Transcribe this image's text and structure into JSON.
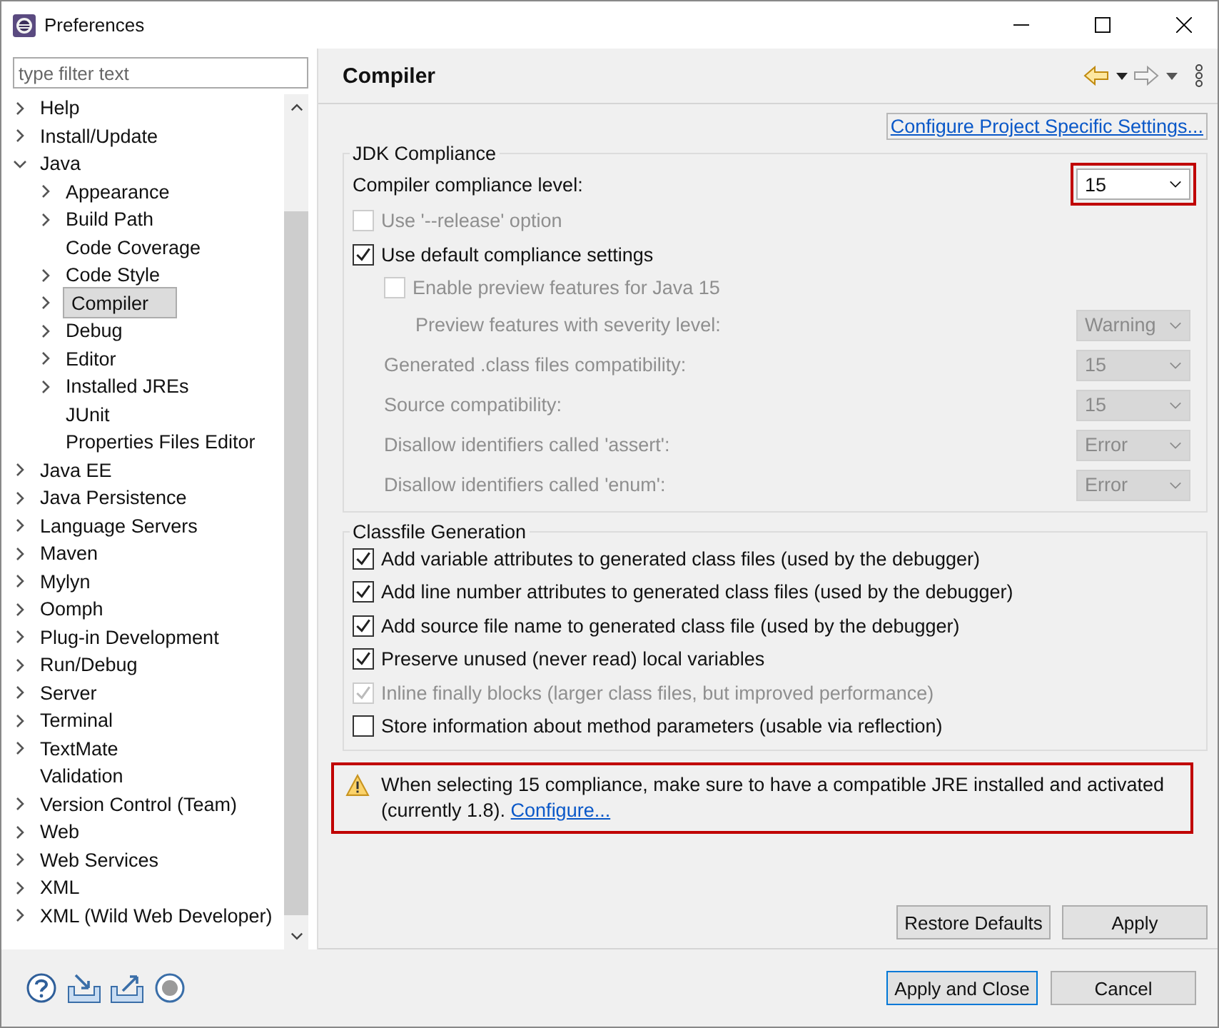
{
  "window": {
    "title": "Preferences"
  },
  "filter": {
    "placeholder": "type filter text"
  },
  "tree": [
    {
      "label": "Help",
      "kind": "branch",
      "expanded": false,
      "selected": false
    },
    {
      "label": "Install/Update",
      "kind": "branch",
      "expanded": false,
      "selected": false
    },
    {
      "label": "Java",
      "kind": "branch",
      "expanded": true,
      "selected": false,
      "children": [
        {
          "label": "Appearance",
          "kind": "branch",
          "expanded": false,
          "selected": false
        },
        {
          "label": "Build Path",
          "kind": "branch",
          "expanded": false,
          "selected": false
        },
        {
          "label": "Code Coverage",
          "kind": "leaf",
          "selected": false
        },
        {
          "label": "Code Style",
          "kind": "branch",
          "expanded": false,
          "selected": false
        },
        {
          "label": "Compiler",
          "kind": "branch",
          "expanded": false,
          "selected": true
        },
        {
          "label": "Debug",
          "kind": "branch",
          "expanded": false,
          "selected": false
        },
        {
          "label": "Editor",
          "kind": "branch",
          "expanded": false,
          "selected": false
        },
        {
          "label": "Installed JREs",
          "kind": "branch",
          "expanded": false,
          "selected": false
        },
        {
          "label": "JUnit",
          "kind": "leaf",
          "selected": false
        },
        {
          "label": "Properties Files Editor",
          "kind": "leaf",
          "selected": false
        }
      ]
    },
    {
      "label": "Java EE",
      "kind": "branch",
      "expanded": false,
      "selected": false
    },
    {
      "label": "Java Persistence",
      "kind": "branch",
      "expanded": false,
      "selected": false
    },
    {
      "label": "Language Servers",
      "kind": "branch",
      "expanded": false,
      "selected": false
    },
    {
      "label": "Maven",
      "kind": "branch",
      "expanded": false,
      "selected": false
    },
    {
      "label": "Mylyn",
      "kind": "branch",
      "expanded": false,
      "selected": false
    },
    {
      "label": "Oomph",
      "kind": "branch",
      "expanded": false,
      "selected": false
    },
    {
      "label": "Plug-in Development",
      "kind": "branch",
      "expanded": false,
      "selected": false
    },
    {
      "label": "Run/Debug",
      "kind": "branch",
      "expanded": false,
      "selected": false
    },
    {
      "label": "Server",
      "kind": "branch",
      "expanded": false,
      "selected": false
    },
    {
      "label": "Terminal",
      "kind": "branch",
      "expanded": false,
      "selected": false
    },
    {
      "label": "TextMate",
      "kind": "branch",
      "expanded": false,
      "selected": false
    },
    {
      "label": "Validation",
      "kind": "leaf",
      "selected": false
    },
    {
      "label": "Version Control (Team)",
      "kind": "branch",
      "expanded": false,
      "selected": false
    },
    {
      "label": "Web",
      "kind": "branch",
      "expanded": false,
      "selected": false
    },
    {
      "label": "Web Services",
      "kind": "branch",
      "expanded": false,
      "selected": false
    },
    {
      "label": "XML",
      "kind": "branch",
      "expanded": false,
      "selected": false
    },
    {
      "label": "XML (Wild Web Developer)",
      "kind": "branch",
      "expanded": false,
      "selected": false
    }
  ],
  "page": {
    "title": "Compiler",
    "project_link": "Configure Project Specific Settings..."
  },
  "jdk_compliance": {
    "title": "JDK Compliance",
    "rows": [
      {
        "kind": "select",
        "label": "Compiler compliance level:",
        "value": "15",
        "disabled": false,
        "highlighted": true
      },
      {
        "kind": "checkbox",
        "label": "Use '--release' option",
        "checked": false,
        "disabled": true
      },
      {
        "kind": "checkbox",
        "label": "Use default compliance settings",
        "checked": true,
        "disabled": false
      },
      {
        "kind": "sub-checkbox",
        "label": "Enable preview features for Java 15",
        "checked": false,
        "disabled": true
      },
      {
        "kind": "sub-sub-select",
        "label": "Preview features with severity level:",
        "value": "Warning",
        "disabled": true,
        "highlighted": false
      },
      {
        "kind": "sub-select",
        "label": "Generated .class files compatibility:",
        "value": "15",
        "disabled": true,
        "highlighted": false
      },
      {
        "kind": "sub-select",
        "label": "Source compatibility:",
        "value": "15",
        "disabled": true,
        "highlighted": false
      },
      {
        "kind": "sub-select",
        "label": "Disallow identifiers called 'assert':",
        "value": "Error",
        "disabled": true,
        "highlighted": false
      },
      {
        "kind": "sub-select",
        "label": "Disallow identifiers called 'enum':",
        "value": "Error",
        "disabled": true,
        "highlighted": false
      }
    ]
  },
  "classfile_generation": {
    "title": "Classfile Generation",
    "options": [
      {
        "label": "Add variable attributes to generated class files (used by the debugger)",
        "checked": true,
        "disabled": false
      },
      {
        "label": "Add line number attributes to generated class files (used by the debugger)",
        "checked": true,
        "disabled": false
      },
      {
        "label": "Add source file name to generated class file (used by the debugger)",
        "checked": true,
        "disabled": false
      },
      {
        "label": "Preserve unused (never read) local variables",
        "checked": true,
        "disabled": false
      },
      {
        "label": "Inline finally blocks (larger class files, but improved performance)",
        "checked": true,
        "disabled": true
      },
      {
        "label": "Store information about method parameters (usable via reflection)",
        "checked": false,
        "disabled": false
      }
    ]
  },
  "warning": {
    "text": "When selecting 15 compliance, make sure to have a compatible JRE installed and activated (currently 1.8).",
    "link": "Configure...",
    "highlighted": true
  },
  "page_buttons": [
    "Restore Defaults",
    "Apply"
  ],
  "dialog_buttons": [
    {
      "label": "Apply and Close",
      "default": true
    },
    {
      "label": "Cancel",
      "default": false
    }
  ]
}
